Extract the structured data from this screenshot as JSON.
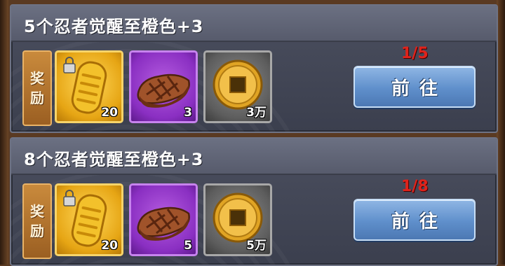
{
  "tasks": [
    {
      "title": "5个忍者觉醒至橙色+3",
      "reward_label_1": "奖",
      "reward_label_2": "励",
      "rewards": [
        {
          "icon": "locked-scroll-icon",
          "rarity": "gold",
          "qty": "20"
        },
        {
          "icon": "meat-icon",
          "rarity": "purple",
          "qty": "3"
        },
        {
          "icon": "coin-icon",
          "rarity": "grey",
          "qty": "3万"
        }
      ],
      "progress": "1/5",
      "button_label": "前往"
    },
    {
      "title": "8个忍者觉醒至橙色+3",
      "reward_label_1": "奖",
      "reward_label_2": "励",
      "rewards": [
        {
          "icon": "locked-scroll-icon",
          "rarity": "gold",
          "qty": "20"
        },
        {
          "icon": "meat-icon",
          "rarity": "purple",
          "qty": "5"
        },
        {
          "icon": "coin-icon",
          "rarity": "grey",
          "qty": "5万"
        }
      ],
      "progress": "1/8",
      "button_label": "前往"
    }
  ],
  "colors": {
    "progress_red": "#e0231b",
    "button_blue": "#5f8fcb",
    "panel": "#4b4f5f"
  }
}
